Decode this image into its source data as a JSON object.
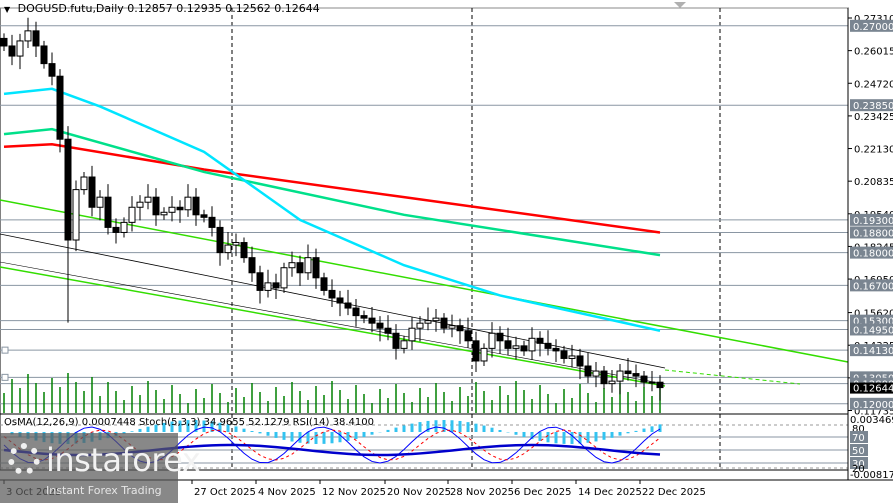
{
  "header": {
    "symbol": "DOGUSD.futu,Daily",
    "open": "0.12857",
    "high": "0.12935",
    "low": "0.12562",
    "close": "0.12644"
  },
  "indicator_header": "OsMA(12,26,9) 0.0007448  Stoch(5,3,3) 34.9655 52.1279  RSI(14) 38.4100",
  "price_ticks": [
    "0.27310",
    "0.26015",
    "0.24720",
    "0.23425",
    "0.22130",
    "0.20835",
    "0.19540",
    "0.18245",
    "0.16950",
    "0.15620",
    "0.14325",
    "0.13030",
    "0.11735"
  ],
  "levels": [
    "0.27000",
    "0.23850",
    "0.19300",
    "0.18800",
    "0.18000",
    "0.16700",
    "0.15300",
    "0.14950",
    "0.14130",
    "0.13050",
    "0.12800",
    "0.12000"
  ],
  "current_price": "0.12644",
  "indicator_scale": {
    "top": "0.003469",
    "bottom": "-0.008178",
    "levels": [
      "80",
      "70",
      "50",
      "30",
      "20"
    ]
  },
  "dates": [
    "3 Oct 2025",
    "27 Oct 2025",
    "4 Nov 2025",
    "12 Nov 2025",
    "20 Nov 2025",
    "28 Nov 2025",
    "6 Dec 2025",
    "14 Dec 2025",
    "22 Dec 2025"
  ],
  "logo": {
    "name": "instaforex",
    "tagline": "Instant Forex Trading"
  },
  "colors": {
    "ma_slow": "#ff0000",
    "ma_mid": "#00e08a",
    "ma_fast": "#00e5ff",
    "channel": "#33dd00",
    "volume": "#008000",
    "level_bg": "#7a8591"
  },
  "chart_data": {
    "type": "candlestick",
    "closes": [
      0.262,
      0.258,
      0.264,
      0.268,
      0.262,
      0.255,
      0.25,
      0.225,
      0.185,
      0.205,
      0.21,
      0.198,
      0.202,
      0.19,
      0.188,
      0.192,
      0.198,
      0.2,
      0.202,
      0.195,
      0.196,
      0.198,
      0.197,
      0.202,
      0.195,
      0.194,
      0.19,
      0.18,
      0.183,
      0.184,
      0.178,
      0.172,
      0.165,
      0.168,
      0.166,
      0.174,
      0.176,
      0.172,
      0.178,
      0.17,
      0.165,
      0.162,
      0.16,
      0.158,
      0.155,
      0.154,
      0.152,
      0.15,
      0.148,
      0.142,
      0.145,
      0.15,
      0.152,
      0.153,
      0.154,
      0.15,
      0.151,
      0.149,
      0.145,
      0.137,
      0.142,
      0.148,
      0.145,
      0.142,
      0.143,
      0.141,
      0.146,
      0.144,
      0.142,
      0.141,
      0.138,
      0.139,
      0.135,
      0.131,
      0.133,
      0.128,
      0.129,
      0.133,
      0.132,
      0.131,
      0.1286,
      0.12857,
      0.12644
    ],
    "ma_fast": [
      [
        0,
        0.243
      ],
      [
        6,
        0.245
      ],
      [
        12,
        0.238
      ],
      [
        25,
        0.22
      ],
      [
        37,
        0.193
      ],
      [
        50,
        0.175
      ],
      [
        62,
        0.163
      ],
      [
        82,
        0.149
      ]
    ],
    "ma_mid": [
      [
        0,
        0.227
      ],
      [
        6,
        0.229
      ],
      [
        25,
        0.212
      ],
      [
        50,
        0.195
      ],
      [
        82,
        0.179
      ]
    ],
    "ma_slow": [
      [
        0,
        0.222
      ],
      [
        6,
        0.223
      ],
      [
        25,
        0.213
      ],
      [
        50,
        0.202
      ],
      [
        82,
        0.188
      ]
    ]
  }
}
